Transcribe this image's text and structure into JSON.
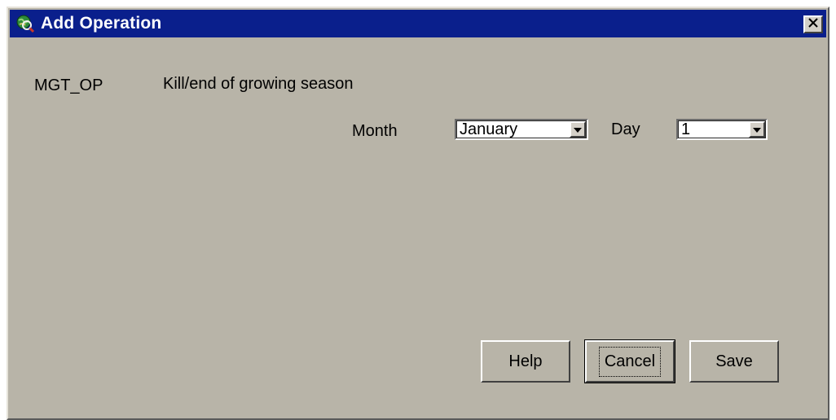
{
  "window": {
    "title": "Add Operation",
    "icon": "globe-magnifier-icon",
    "close_icon": "close-icon"
  },
  "operation": {
    "code_label": "MGT_OP",
    "name": "Kill/end of growing season"
  },
  "schedule": {
    "month_label": "Month",
    "month_value": "January",
    "day_label": "Day",
    "day_value": "1"
  },
  "buttons": {
    "help": "Help",
    "cancel": "Cancel",
    "save": "Save"
  },
  "colors": {
    "titlebar": "#0a1f8c",
    "dialog_background": "#b8b4a8"
  }
}
